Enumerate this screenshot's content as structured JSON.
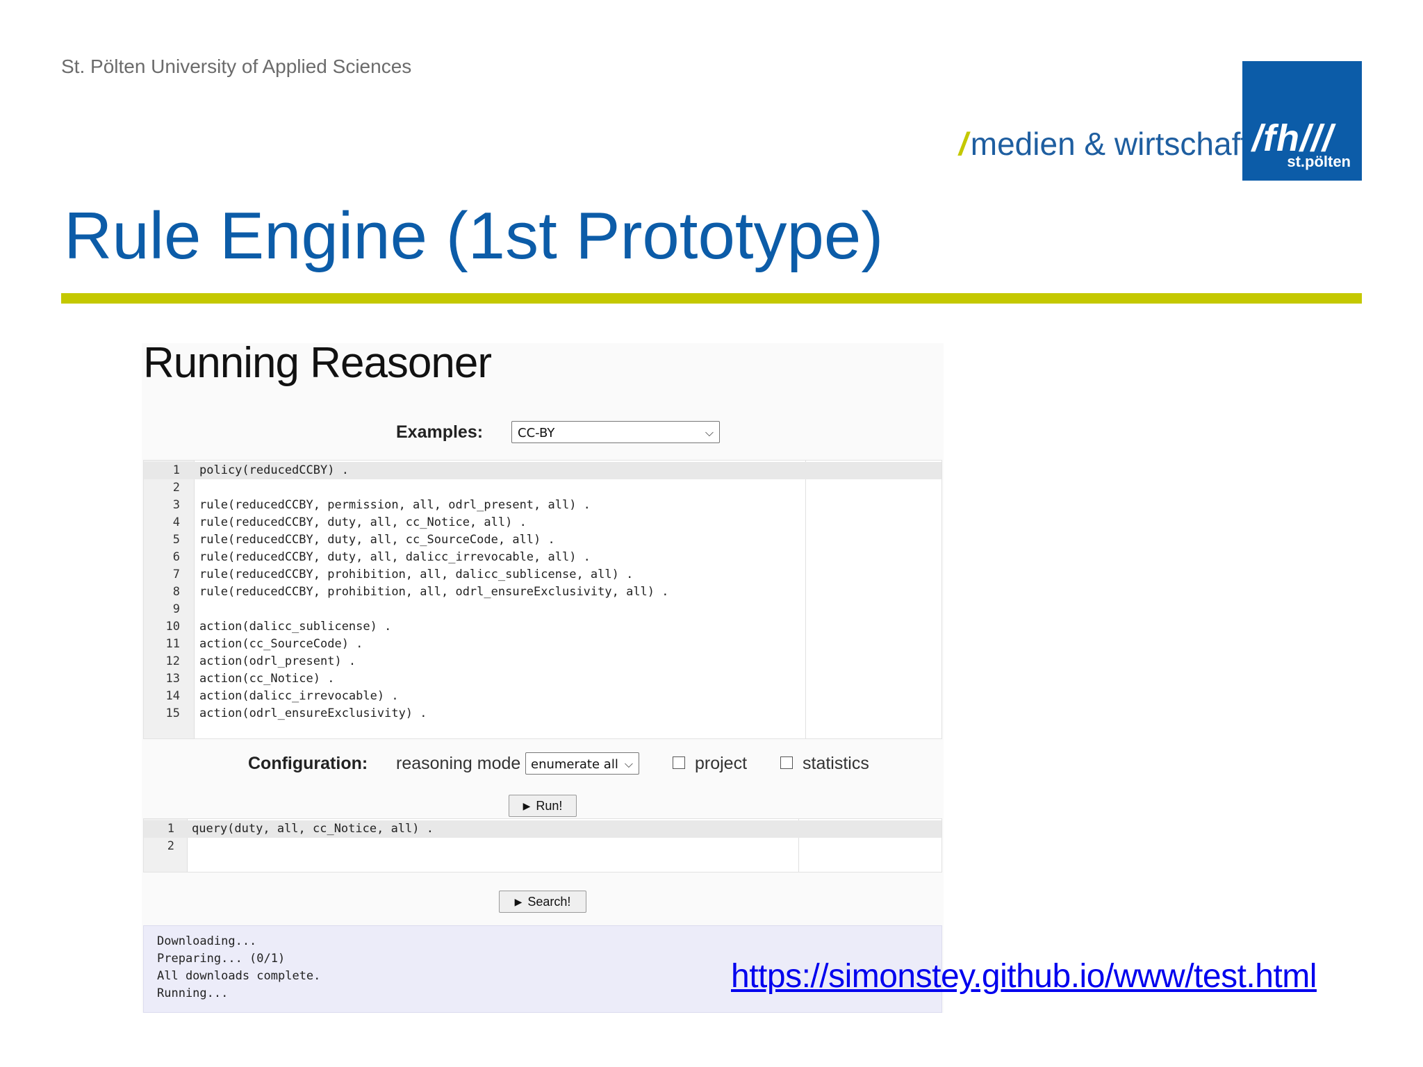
{
  "header": {
    "university": "St. Pölten University of Applied Sciences",
    "brand_slash": "/",
    "brand_text": "medien & wirtschaft",
    "logo_main": "/fh///",
    "logo_sub": "st.pölten",
    "title": "Rule Engine (1st Prototype)"
  },
  "colors": {
    "accent_blue": "#0c5ca8",
    "accent_lime": "#c4c800",
    "link": "#0000ee"
  },
  "app": {
    "heading": "Running Reasoner",
    "examples_label": "Examples:",
    "examples_selected": "CC-BY",
    "editor_lines": [
      {
        "n": "1",
        "t": "policy(reducedCCBY) ."
      },
      {
        "n": "2",
        "t": ""
      },
      {
        "n": "3",
        "t": "rule(reducedCCBY, permission, all, odrl_present, all) ."
      },
      {
        "n": "4",
        "t": "rule(reducedCCBY, duty, all, cc_Notice, all) ."
      },
      {
        "n": "5",
        "t": "rule(reducedCCBY, duty, all, cc_SourceCode, all) ."
      },
      {
        "n": "6",
        "t": "rule(reducedCCBY, duty, all, dalicc_irrevocable, all) ."
      },
      {
        "n": "7",
        "t": "rule(reducedCCBY, prohibition, all, dalicc_sublicense, all) ."
      },
      {
        "n": "8",
        "t": "rule(reducedCCBY, prohibition, all, odrl_ensureExclusivity, all) ."
      },
      {
        "n": "9",
        "t": ""
      },
      {
        "n": "10",
        "t": "action(dalicc_sublicense) ."
      },
      {
        "n": "11",
        "t": "action(cc_SourceCode) ."
      },
      {
        "n": "12",
        "t": "action(odrl_present) ."
      },
      {
        "n": "13",
        "t": "action(cc_Notice) ."
      },
      {
        "n": "14",
        "t": "action(dalicc_irrevocable) ."
      },
      {
        "n": "15",
        "t": "action(odrl_ensureExclusivity) ."
      }
    ],
    "config_label": "Configuration:",
    "reasoning_mode_label": "reasoning mode",
    "reasoning_mode_selected": "enumerate all",
    "project_label": "project",
    "project_checked": false,
    "statistics_label": "statistics",
    "statistics_checked": false,
    "run_label": "Run!",
    "query_lines": [
      {
        "n": "1",
        "t": "query(duty, all, cc_Notice, all) ."
      },
      {
        "n": "2",
        "t": ""
      }
    ],
    "search_label": "Search!",
    "play_icon": "▶",
    "dropdown_icon": "⌵",
    "output_lines": [
      "Downloading...",
      "Preparing... (0/1)",
      "All downloads complete.",
      "Running..."
    ]
  },
  "link": "https://simonstey.github.io/www/test.html"
}
